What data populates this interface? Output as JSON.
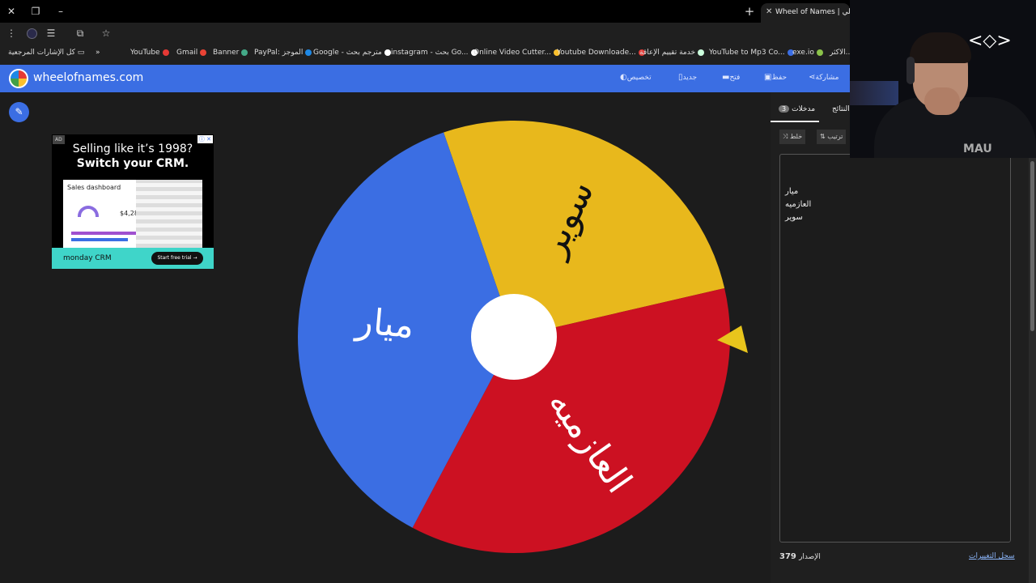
{
  "browser": {
    "tab_title": "Wheel of Names | الي",
    "window_controls": {
      "close": "✕",
      "restore": "❐",
      "minimize": "–",
      "new_tab": "+"
    }
  },
  "bookmarks": {
    "all_bookmarks": "كل الإشارات المرجعية",
    "overflow": "»",
    "items": [
      "YouTube",
      "Gmail",
      "Banner",
      "PayPal: الموجز",
      "Google - مترجم بحث",
      "instagram - بحث Go...",
      "Online Video Cutter...",
      "Youtube Downloade...",
      "خدمة تقييم الإعاقة",
      "YouTube to Mp3 Co...",
      "exe.io",
      "الاكثر..."
    ]
  },
  "app": {
    "site_name": "wheelofnames.com",
    "nav": {
      "share": "مشاركة",
      "save": "حفظ",
      "open": "فتح",
      "new": "جديد",
      "customize": "تخصيص"
    }
  },
  "ad": {
    "badge": "AD",
    "headline1": "Selling like it’s 1998?",
    "headline2": "Switch your CRM.",
    "dashboard_title": "Sales dashboard",
    "dashboard_value": "$4,28",
    "brand": "monday CRM",
    "cta": "Start free trial →"
  },
  "wheel": {
    "segments": [
      {
        "label": "سوير",
        "color": "#e8b81c",
        "text_color": "#111111"
      },
      {
        "label": "العازميه",
        "color": "#cc1122",
        "text_color": "#ffffff"
      },
      {
        "label": "ميار",
        "color": "#3b6ee3",
        "text_color": "#ffffff"
      }
    ],
    "pointer_color": "#e8c51c",
    "center_color": "#ffffff"
  },
  "panel": {
    "tab_entries": "مدخلات",
    "entries_count": "3",
    "tab_results": "النتائج",
    "shuffle": "خلط",
    "sort": "ترتيب",
    "entries": [
      "ميار",
      "العازميه",
      "سوير"
    ],
    "version_label": "الإصدار",
    "version_number": "379",
    "changelog": "سجل التغييرات"
  },
  "webcam": {
    "logo": "<◇>",
    "shirt_text": "MAU"
  }
}
